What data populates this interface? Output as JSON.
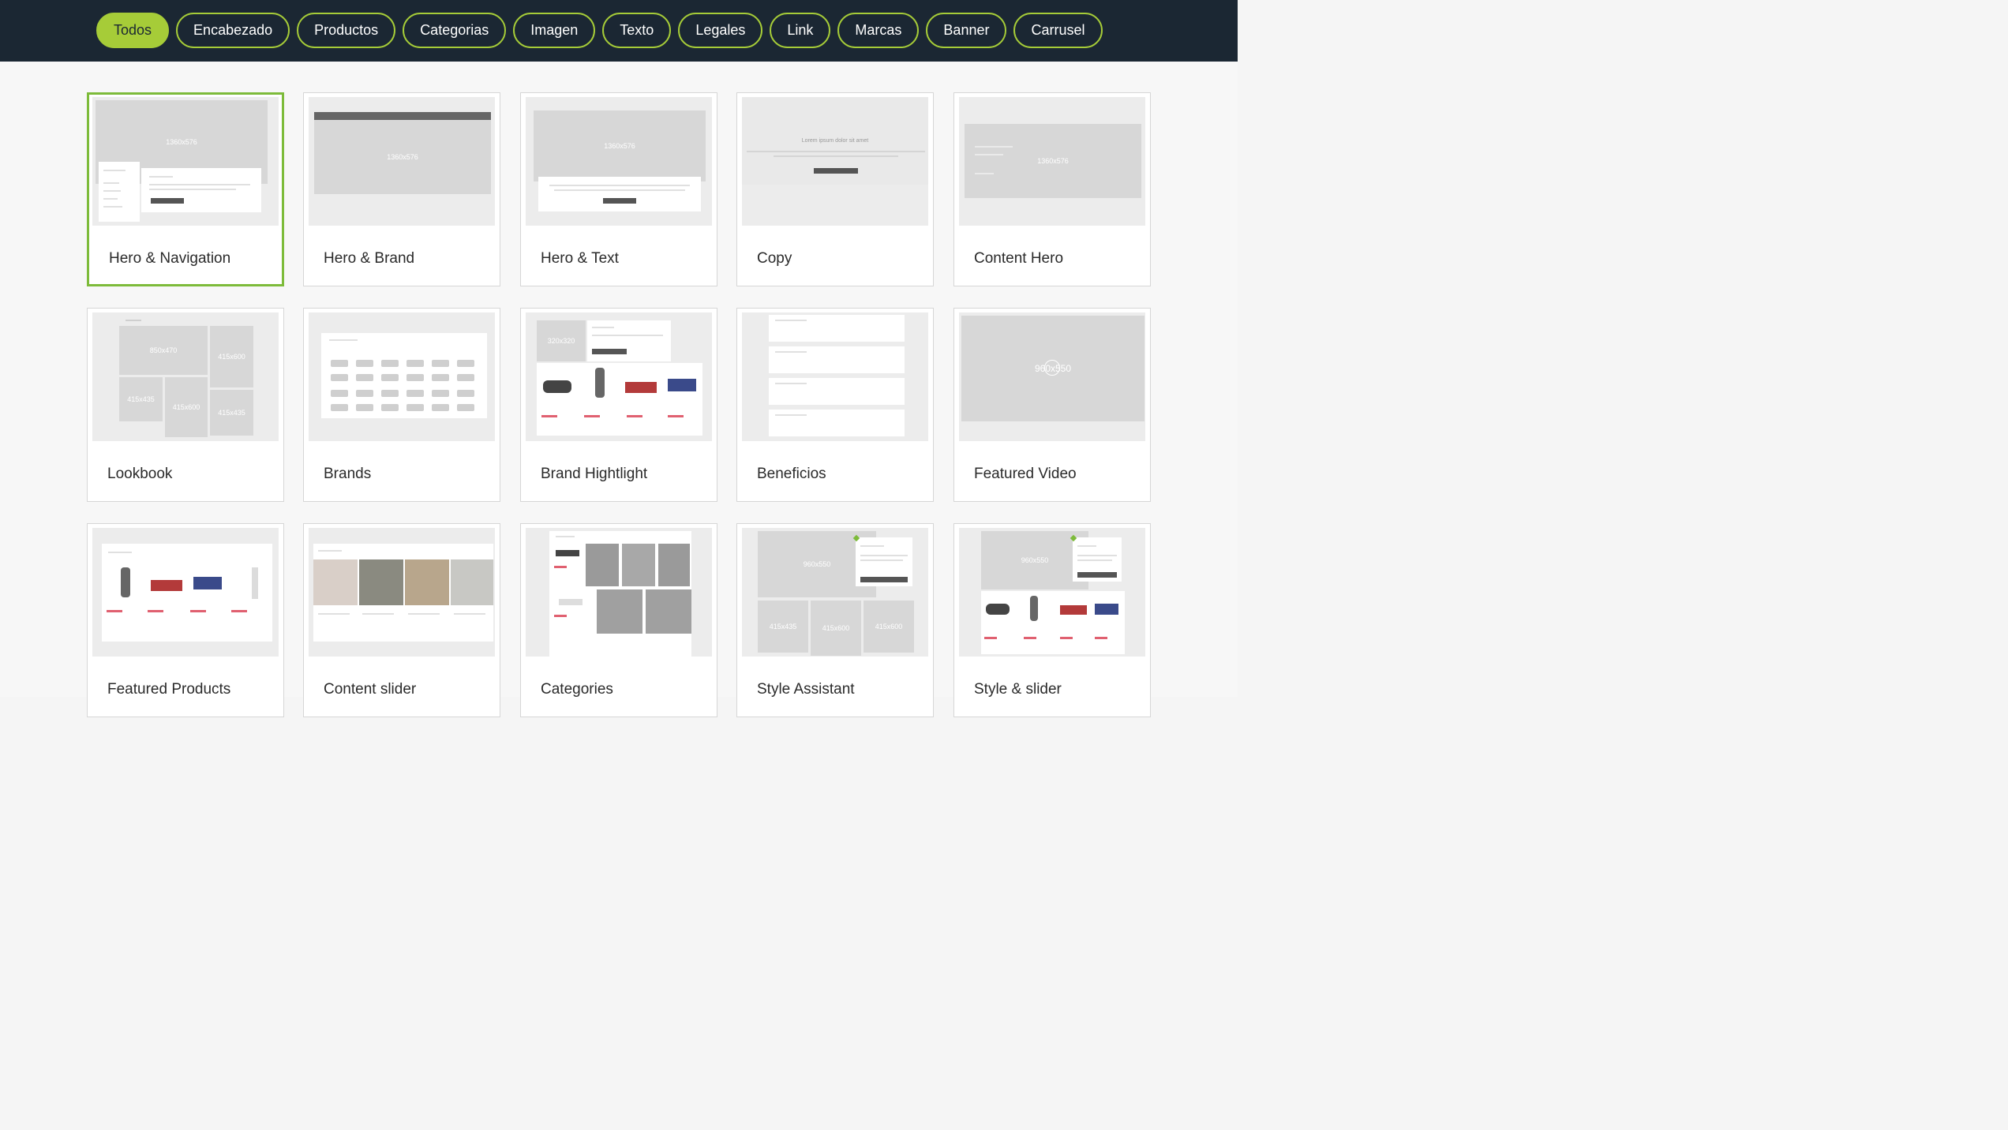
{
  "filters": [
    {
      "label": "Todos",
      "active": true
    },
    {
      "label": "Encabezado",
      "active": false
    },
    {
      "label": "Productos",
      "active": false
    },
    {
      "label": "Categorias",
      "active": false
    },
    {
      "label": "Imagen",
      "active": false
    },
    {
      "label": "Texto",
      "active": false
    },
    {
      "label": "Legales",
      "active": false
    },
    {
      "label": "Link",
      "active": false
    },
    {
      "label": "Marcas",
      "active": false
    },
    {
      "label": "Banner",
      "active": false
    },
    {
      "label": "Carrusel",
      "active": false
    }
  ],
  "cards": [
    {
      "label": "Hero & Navigation",
      "selected": true
    },
    {
      "label": "Hero & Brand",
      "selected": false
    },
    {
      "label": "Hero & Text",
      "selected": false
    },
    {
      "label": "Copy",
      "selected": false
    },
    {
      "label": "Content Hero",
      "selected": false
    },
    {
      "label": "Lookbook",
      "selected": false
    },
    {
      "label": "Brands",
      "selected": false
    },
    {
      "label": "Brand Hightlight",
      "selected": false
    },
    {
      "label": "Beneficios",
      "selected": false
    },
    {
      "label": "Featured Video",
      "selected": false
    },
    {
      "label": "Featured Products",
      "selected": false
    },
    {
      "label": "Content slider",
      "selected": false
    },
    {
      "label": "Categories",
      "selected": false
    },
    {
      "label": "Style Assistant",
      "selected": false
    },
    {
      "label": "Style & slider",
      "selected": false
    }
  ],
  "thumb_text": {
    "hero_nav": "1360x576",
    "hero_brand": "1360x576",
    "hero_text": "1360x576",
    "copy_title": "Lorem ipsum dolor sit amet",
    "content_hero": "1360x576",
    "lookbook_main": "850x470",
    "lookbook_a": "415x600",
    "lookbook_b": "415x435",
    "lookbook_c": "415x600",
    "lookbook_d": "415x435",
    "brand_hl": "320x320",
    "video": "960x550",
    "style_assistant_main": "960x550",
    "style_assistant_a": "415x435",
    "style_assistant_b": "415x600",
    "style_assistant_c": "415x600",
    "style_slider": "960x550"
  },
  "colors": {
    "topbar": "#1b2733",
    "accent": "#a6cc38",
    "selected_border": "#7dbb3a"
  }
}
